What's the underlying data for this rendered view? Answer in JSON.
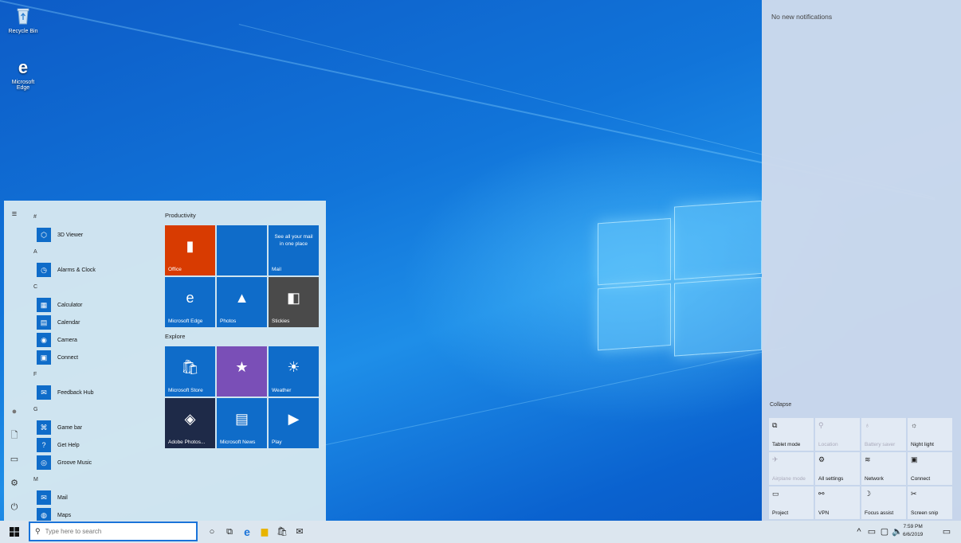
{
  "desktop": {
    "icons": [
      {
        "label": "Recycle Bin",
        "icon": "recycle-bin-icon"
      },
      {
        "label": "Microsoft Edge",
        "icon": "edge-icon"
      }
    ]
  },
  "start_menu": {
    "rail": [
      {
        "icon": "hamburger-menu-icon",
        "glyph": "≡"
      },
      {
        "icon": "user-avatar-icon",
        "glyph": "●"
      },
      {
        "icon": "documents-icon",
        "glyph": "🗋"
      },
      {
        "icon": "pictures-icon",
        "glyph": "▭"
      },
      {
        "icon": "settings-gear-icon",
        "glyph": "⚙"
      },
      {
        "icon": "power-icon",
        "glyph": "⏻"
      }
    ],
    "app_list": [
      {
        "type": "letter",
        "text": "#"
      },
      {
        "type": "app",
        "text": "3D Viewer",
        "glyph": "⬡"
      },
      {
        "type": "letter",
        "text": "A"
      },
      {
        "type": "app",
        "text": "Alarms & Clock",
        "glyph": "◷"
      },
      {
        "type": "letter",
        "text": "C"
      },
      {
        "type": "app",
        "text": "Calculator",
        "glyph": "▦"
      },
      {
        "type": "app",
        "text": "Calendar",
        "glyph": "▤"
      },
      {
        "type": "app",
        "text": "Camera",
        "glyph": "◉"
      },
      {
        "type": "app",
        "text": "Connect",
        "glyph": "▣"
      },
      {
        "type": "letter",
        "text": "F"
      },
      {
        "type": "app",
        "text": "Feedback Hub",
        "glyph": "✉"
      },
      {
        "type": "letter",
        "text": "G"
      },
      {
        "type": "app",
        "text": "Game bar",
        "glyph": "⌘"
      },
      {
        "type": "app",
        "text": "Get Help",
        "glyph": "?"
      },
      {
        "type": "app",
        "text": "Groove Music",
        "glyph": "◎"
      },
      {
        "type": "letter",
        "text": "M"
      },
      {
        "type": "app",
        "text": "Mail",
        "glyph": "✉"
      },
      {
        "type": "app",
        "text": "Maps",
        "glyph": "◍"
      }
    ],
    "groups": [
      {
        "title": "Productivity"
      },
      {
        "title": "Explore"
      }
    ],
    "tiles": [
      {
        "label": "Office",
        "color": "#d83b01",
        "glyph": "▮"
      },
      {
        "label": "",
        "color": "#0f6cc9",
        "glyph": ""
      },
      {
        "label": "Mail",
        "color": "#0f6cc9",
        "text": "See all your mail in one place",
        "glyph": "✉"
      },
      {
        "label": "Microsoft Edge",
        "color": "#0f6cc9",
        "glyph": "e"
      },
      {
        "label": "Photos",
        "color": "#0f6cc9",
        "glyph": "▲"
      },
      {
        "label": "Stickies",
        "color": "#4a4a4a",
        "glyph": "◧"
      },
      {
        "label": "Microsoft Store",
        "color": "#0f6cc9",
        "glyph": "🛍"
      },
      {
        "label": "",
        "color": "#7a4fb7",
        "glyph": "★"
      },
      {
        "label": "Weather",
        "color": "#0f6cc9",
        "glyph": "☀"
      },
      {
        "label": "Adobe Photos...",
        "color": "#1e2a48",
        "glyph": "◈"
      },
      {
        "label": "Microsoft News",
        "color": "#0f6cc9",
        "glyph": "▤"
      },
      {
        "label": "Play",
        "color": "#0f6cc9",
        "glyph": "▶"
      }
    ]
  },
  "action_center": {
    "no_notifications": "No new notifications",
    "collapse": "Collapse",
    "quick_actions": [
      {
        "label": "Tablet mode",
        "glyph": "⧉",
        "dim": false
      },
      {
        "label": "Location",
        "glyph": "⚲",
        "dim": true
      },
      {
        "label": "Battery saver",
        "glyph": "♁",
        "dim": true
      },
      {
        "label": "Night light",
        "glyph": "☼",
        "dim": false
      },
      {
        "label": "Airplane mode",
        "glyph": "✈",
        "dim": true
      },
      {
        "label": "All settings",
        "glyph": "⚙",
        "dim": false
      },
      {
        "label": "Network",
        "glyph": "≋",
        "dim": false
      },
      {
        "label": "Connect",
        "glyph": "▣",
        "dim": false
      },
      {
        "label": "Project",
        "glyph": "▭",
        "dim": false
      },
      {
        "label": "VPN",
        "glyph": "⚯",
        "dim": false
      },
      {
        "label": "Focus assist",
        "glyph": "☽",
        "dim": false
      },
      {
        "label": "Screen snip",
        "glyph": "✂",
        "dim": false
      }
    ]
  },
  "taskbar": {
    "search_placeholder": "Type here to search",
    "pinned": [
      {
        "icon": "cortana-icon",
        "glyph": "○"
      },
      {
        "icon": "task-view-icon",
        "glyph": "⧉"
      },
      {
        "icon": "edge-icon",
        "glyph": "e"
      },
      {
        "icon": "file-explorer-icon",
        "glyph": "▆"
      },
      {
        "icon": "store-icon",
        "glyph": "🛍"
      },
      {
        "icon": "mail-icon",
        "glyph": "✉"
      }
    ],
    "time": "7:59 PM",
    "date": "6/6/2019"
  }
}
